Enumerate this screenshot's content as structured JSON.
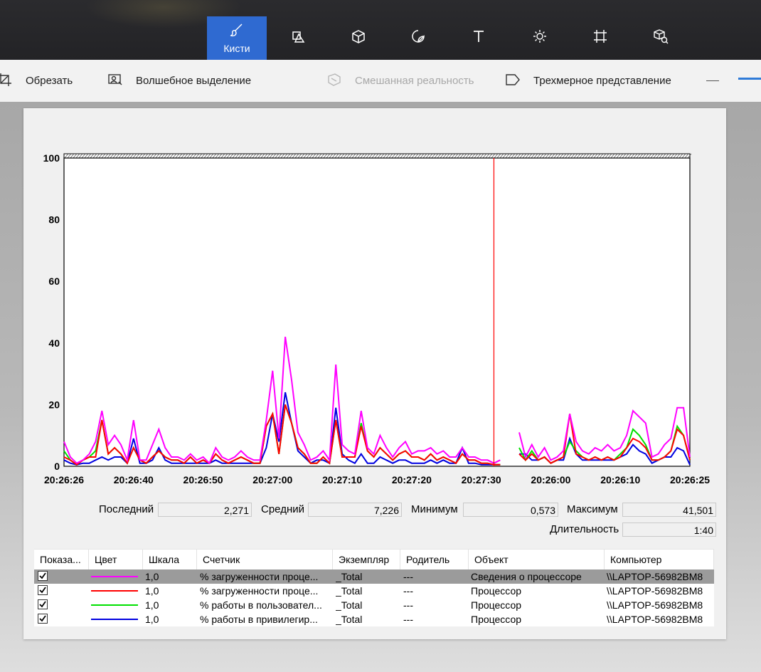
{
  "toolbar": {
    "tools": [
      {
        "name": "brushes-tool",
        "icon": "brush-icon",
        "label": "Кисти",
        "active": true
      },
      {
        "name": "2d-shapes-tool",
        "icon": "shapes-2d-icon",
        "label": ""
      },
      {
        "name": "3d-shapes-tool",
        "icon": "cube-icon",
        "label": ""
      },
      {
        "name": "stickers-tool",
        "icon": "sticker-icon",
        "label": ""
      },
      {
        "name": "text-tool",
        "icon": "text-icon",
        "label": ""
      },
      {
        "name": "effects-tool",
        "icon": "sun-icon",
        "label": ""
      },
      {
        "name": "canvas-tool",
        "icon": "canvas-crop-icon",
        "label": ""
      },
      {
        "name": "3d-library-tool",
        "icon": "3d-library-icon",
        "label": ""
      }
    ],
    "active_color": "#2f6ad1"
  },
  "subbar": {
    "crop": "Обрезать",
    "magic_select": "Волшебное выделение",
    "mixed_reality": "Смешанная реальность",
    "view_3d": "Трехмерное представление"
  },
  "chart_data": {
    "type": "line",
    "ylim": [
      0,
      100
    ],
    "yticks": [
      "100",
      "80",
      "60",
      "40",
      "20",
      "0"
    ],
    "xtick_labels": [
      "20:26:26",
      "20:26:40",
      "20:26:50",
      "20:27:00",
      "20:27:10",
      "20:27:20",
      "20:27:30",
      "20:26:00",
      "20:26:10",
      "20:26:25"
    ],
    "x_samples": 100,
    "cursor_index": 68,
    "gap_after_index": 69,
    "series": [
      {
        "name": "% загруженности проце...",
        "color": "#ff00ff",
        "values": [
          8,
          3,
          1,
          2,
          4,
          8,
          18,
          7,
          10,
          7,
          2,
          15,
          2,
          2,
          7,
          12,
          6,
          3,
          3,
          2,
          4,
          2,
          3,
          1,
          6,
          3,
          2,
          3,
          5,
          3,
          2,
          2,
          15,
          31,
          9,
          42,
          28,
          11,
          7,
          2,
          3,
          5,
          2,
          33,
          7,
          5,
          4,
          18,
          6,
          4,
          10,
          6,
          3,
          6,
          8,
          4,
          5,
          5,
          6,
          4,
          5,
          3,
          3,
          6,
          3,
          3,
          2,
          2,
          1,
          2,
          null,
          null,
          11,
          3,
          7,
          3,
          6,
          2,
          3,
          5,
          17,
          8,
          5,
          4,
          6,
          5,
          7,
          5,
          6,
          10,
          18,
          16,
          14,
          3,
          4,
          7,
          9,
          19,
          19,
          3
        ]
      },
      {
        "name": "% загруженности проце...",
        "color": "#ff0000",
        "values": [
          3,
          2,
          0.5,
          2,
          3,
          3,
          15,
          4,
          6,
          4,
          1,
          6,
          2,
          1,
          3,
          5,
          3,
          2,
          2,
          1,
          3,
          1,
          2,
          1,
          4,
          2,
          1,
          2,
          3,
          2,
          1,
          1,
          13,
          17,
          4,
          20,
          14,
          6,
          4,
          1,
          1,
          3,
          1,
          15,
          3,
          3,
          3,
          13,
          5,
          3,
          6,
          4,
          2,
          4,
          5,
          3,
          3,
          2,
          4,
          2,
          3,
          2,
          1,
          4,
          2,
          2,
          1,
          1,
          0.5,
          0.5,
          null,
          null,
          4,
          2,
          4,
          2,
          3,
          1,
          2,
          3,
          17,
          4,
          3,
          2,
          3,
          2,
          3,
          2,
          3,
          6,
          9,
          8,
          6,
          2,
          2,
          3,
          5,
          12,
          10,
          2
        ]
      },
      {
        "name": "% работы в пользовател...",
        "color": "#00e000",
        "values": [
          5,
          2,
          0.5,
          2,
          3,
          5,
          15,
          4,
          6,
          4,
          1,
          6,
          2,
          1,
          3,
          5,
          3,
          2,
          2,
          1,
          3,
          1,
          2,
          1,
          4,
          2,
          1,
          2,
          3,
          2,
          1,
          1,
          13,
          17,
          4,
          20,
          14,
          6,
          4,
          1,
          1,
          3,
          1,
          15,
          3,
          3,
          3,
          14,
          5,
          3,
          6,
          4,
          2,
          4,
          5,
          3,
          3,
          2,
          4,
          2,
          3,
          2,
          1,
          4,
          2,
          2,
          1,
          1,
          0.5,
          0.5,
          null,
          null,
          6,
          2,
          5,
          2,
          3,
          1,
          2,
          3,
          8,
          5,
          3,
          2,
          3,
          2,
          3,
          2,
          4,
          6,
          12,
          10,
          7,
          2,
          2,
          3,
          5,
          13,
          10,
          2
        ]
      },
      {
        "name": "% работы в привилегир...",
        "color": "#0000e0",
        "values": [
          2,
          1,
          0.5,
          1,
          1,
          2,
          3,
          2,
          3,
          3,
          1,
          9,
          1,
          1,
          2,
          6,
          2,
          1,
          1,
          1,
          1,
          1,
          1,
          1,
          2,
          1,
          1,
          1,
          1,
          1,
          1,
          1,
          6,
          17,
          8,
          24,
          14,
          5,
          3,
          1,
          2,
          2,
          1,
          19,
          4,
          2,
          1,
          4,
          1,
          1,
          3,
          2,
          1,
          2,
          2,
          1,
          1,
          1,
          2,
          1,
          2,
          1,
          1,
          6,
          1,
          1,
          0.5,
          0.5,
          0.5,
          0.5,
          null,
          null,
          4,
          4,
          2,
          2,
          3,
          1,
          2,
          2,
          9,
          4,
          2,
          2,
          2,
          2,
          2,
          2,
          3,
          4,
          7,
          5,
          4,
          1,
          2,
          3,
          3,
          6,
          5,
          0.5
        ]
      }
    ]
  },
  "stats": {
    "last_label": "Последний",
    "last": "2,271",
    "avg_label": "Средний",
    "avg": "7,226",
    "min_label": "Минимум",
    "min": "0,573",
    "max_label": "Максимум",
    "max": "41,501",
    "duration_label": "Длительность",
    "duration": "1:40"
  },
  "table": {
    "headers": [
      "Показа...",
      "Цвет",
      "Шкала",
      "Счетчик",
      "Экземпляр",
      "Родитель",
      "Объект",
      "Компьютер"
    ],
    "rows": [
      {
        "color": "#ff00ff",
        "scale": "1,0",
        "counter": "% загруженности проце...",
        "instance": "_Total",
        "parent": "---",
        "object": "Сведения о процессоре",
        "computer": "\\\\LAPTOP-56982BM8"
      },
      {
        "color": "#ff0000",
        "scale": "1,0",
        "counter": "% загруженности проце...",
        "instance": "_Total",
        "parent": "---",
        "object": "Процессор",
        "computer": "\\\\LAPTOP-56982BM8"
      },
      {
        "color": "#00e000",
        "scale": "1,0",
        "counter": "% работы в пользовател...",
        "instance": "_Total",
        "parent": "---",
        "object": "Процессор",
        "computer": "\\\\LAPTOP-56982BM8"
      },
      {
        "color": "#0000e0",
        "scale": "1,0",
        "counter": "% работы в привилегир...",
        "instance": "_Total",
        "parent": "---",
        "object": "Процессор",
        "computer": "\\\\LAPTOP-56982BM8"
      }
    ]
  }
}
